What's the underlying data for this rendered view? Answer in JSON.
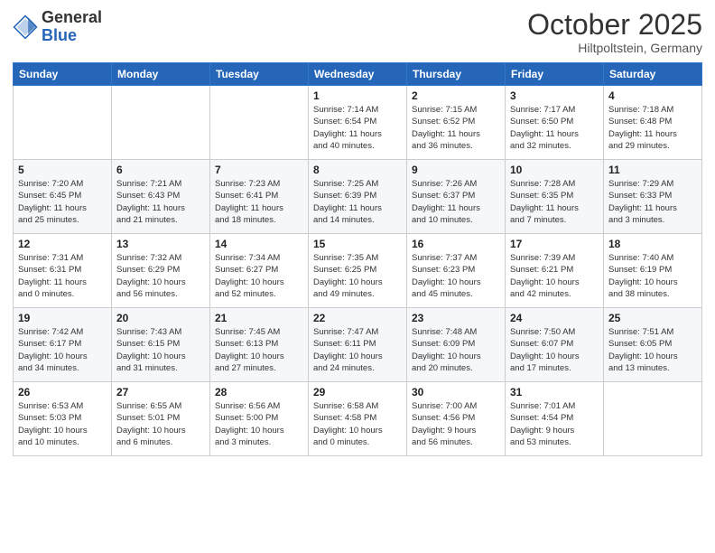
{
  "header": {
    "logo_general": "General",
    "logo_blue": "Blue",
    "month_title": "October 2025",
    "location": "Hiltpoltstein, Germany"
  },
  "columns": [
    "Sunday",
    "Monday",
    "Tuesday",
    "Wednesday",
    "Thursday",
    "Friday",
    "Saturday"
  ],
  "weeks": [
    [
      {
        "day": "",
        "info": ""
      },
      {
        "day": "",
        "info": ""
      },
      {
        "day": "",
        "info": ""
      },
      {
        "day": "1",
        "info": "Sunrise: 7:14 AM\nSunset: 6:54 PM\nDaylight: 11 hours\nand 40 minutes."
      },
      {
        "day": "2",
        "info": "Sunrise: 7:15 AM\nSunset: 6:52 PM\nDaylight: 11 hours\nand 36 minutes."
      },
      {
        "day": "3",
        "info": "Sunrise: 7:17 AM\nSunset: 6:50 PM\nDaylight: 11 hours\nand 32 minutes."
      },
      {
        "day": "4",
        "info": "Sunrise: 7:18 AM\nSunset: 6:48 PM\nDaylight: 11 hours\nand 29 minutes."
      }
    ],
    [
      {
        "day": "5",
        "info": "Sunrise: 7:20 AM\nSunset: 6:45 PM\nDaylight: 11 hours\nand 25 minutes."
      },
      {
        "day": "6",
        "info": "Sunrise: 7:21 AM\nSunset: 6:43 PM\nDaylight: 11 hours\nand 21 minutes."
      },
      {
        "day": "7",
        "info": "Sunrise: 7:23 AM\nSunset: 6:41 PM\nDaylight: 11 hours\nand 18 minutes."
      },
      {
        "day": "8",
        "info": "Sunrise: 7:25 AM\nSunset: 6:39 PM\nDaylight: 11 hours\nand 14 minutes."
      },
      {
        "day": "9",
        "info": "Sunrise: 7:26 AM\nSunset: 6:37 PM\nDaylight: 11 hours\nand 10 minutes."
      },
      {
        "day": "10",
        "info": "Sunrise: 7:28 AM\nSunset: 6:35 PM\nDaylight: 11 hours\nand 7 minutes."
      },
      {
        "day": "11",
        "info": "Sunrise: 7:29 AM\nSunset: 6:33 PM\nDaylight: 11 hours\nand 3 minutes."
      }
    ],
    [
      {
        "day": "12",
        "info": "Sunrise: 7:31 AM\nSunset: 6:31 PM\nDaylight: 11 hours\nand 0 minutes."
      },
      {
        "day": "13",
        "info": "Sunrise: 7:32 AM\nSunset: 6:29 PM\nDaylight: 10 hours\nand 56 minutes."
      },
      {
        "day": "14",
        "info": "Sunrise: 7:34 AM\nSunset: 6:27 PM\nDaylight: 10 hours\nand 52 minutes."
      },
      {
        "day": "15",
        "info": "Sunrise: 7:35 AM\nSunset: 6:25 PM\nDaylight: 10 hours\nand 49 minutes."
      },
      {
        "day": "16",
        "info": "Sunrise: 7:37 AM\nSunset: 6:23 PM\nDaylight: 10 hours\nand 45 minutes."
      },
      {
        "day": "17",
        "info": "Sunrise: 7:39 AM\nSunset: 6:21 PM\nDaylight: 10 hours\nand 42 minutes."
      },
      {
        "day": "18",
        "info": "Sunrise: 7:40 AM\nSunset: 6:19 PM\nDaylight: 10 hours\nand 38 minutes."
      }
    ],
    [
      {
        "day": "19",
        "info": "Sunrise: 7:42 AM\nSunset: 6:17 PM\nDaylight: 10 hours\nand 34 minutes."
      },
      {
        "day": "20",
        "info": "Sunrise: 7:43 AM\nSunset: 6:15 PM\nDaylight: 10 hours\nand 31 minutes."
      },
      {
        "day": "21",
        "info": "Sunrise: 7:45 AM\nSunset: 6:13 PM\nDaylight: 10 hours\nand 27 minutes."
      },
      {
        "day": "22",
        "info": "Sunrise: 7:47 AM\nSunset: 6:11 PM\nDaylight: 10 hours\nand 24 minutes."
      },
      {
        "day": "23",
        "info": "Sunrise: 7:48 AM\nSunset: 6:09 PM\nDaylight: 10 hours\nand 20 minutes."
      },
      {
        "day": "24",
        "info": "Sunrise: 7:50 AM\nSunset: 6:07 PM\nDaylight: 10 hours\nand 17 minutes."
      },
      {
        "day": "25",
        "info": "Sunrise: 7:51 AM\nSunset: 6:05 PM\nDaylight: 10 hours\nand 13 minutes."
      }
    ],
    [
      {
        "day": "26",
        "info": "Sunrise: 6:53 AM\nSunset: 5:03 PM\nDaylight: 10 hours\nand 10 minutes."
      },
      {
        "day": "27",
        "info": "Sunrise: 6:55 AM\nSunset: 5:01 PM\nDaylight: 10 hours\nand 6 minutes."
      },
      {
        "day": "28",
        "info": "Sunrise: 6:56 AM\nSunset: 5:00 PM\nDaylight: 10 hours\nand 3 minutes."
      },
      {
        "day": "29",
        "info": "Sunrise: 6:58 AM\nSunset: 4:58 PM\nDaylight: 10 hours\nand 0 minutes."
      },
      {
        "day": "30",
        "info": "Sunrise: 7:00 AM\nSunset: 4:56 PM\nDaylight: 9 hours\nand 56 minutes."
      },
      {
        "day": "31",
        "info": "Sunrise: 7:01 AM\nSunset: 4:54 PM\nDaylight: 9 hours\nand 53 minutes."
      },
      {
        "day": "",
        "info": ""
      }
    ]
  ]
}
